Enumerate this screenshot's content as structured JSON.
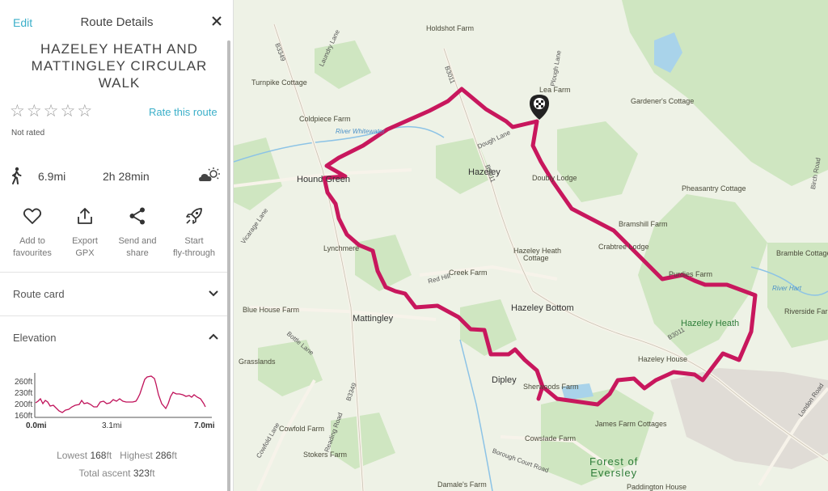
{
  "header": {
    "edit_label": "Edit",
    "title": "Route Details",
    "close_icon": "close-icon"
  },
  "route": {
    "name_line1": "HAZELEY HEATH AND",
    "name_line2": "MATTINGLEY CIRCULAR",
    "name_line3": "WALK"
  },
  "rating": {
    "stars_filled": 0,
    "stars_total": 5,
    "rate_label": "Rate this route",
    "status": "Not rated"
  },
  "stats": {
    "distance_value": "6.9",
    "distance_unit": "mi",
    "hours_value": "2",
    "hours_unit": "h",
    "minutes_value": "28",
    "minutes_unit": "min",
    "walk_icon": "walking-person-icon",
    "weather_icon": "weather-cloud-sun-icon"
  },
  "actions": [
    {
      "icon": "heart-icon",
      "line1": "Add to",
      "line2": "favourites"
    },
    {
      "icon": "export-icon",
      "line1": "Export",
      "line2": "GPX"
    },
    {
      "icon": "share-icon",
      "line1": "Send and",
      "line2": "share"
    },
    {
      "icon": "rocket-icon",
      "line1": "Start",
      "line2": "fly-through"
    }
  ],
  "sections": {
    "route_card": "Route card",
    "elevation": "Elevation"
  },
  "elevation": {
    "y_ticks": [
      "260ft",
      "230ft",
      "200ft",
      "160ft"
    ],
    "x_start": "0.0mi",
    "x_mid": "3.1mi",
    "x_end": "7.0mi",
    "lowest_label": "Lowest",
    "lowest_value": "168",
    "highest_label": "Highest",
    "highest_value": "286",
    "ascent_label": "Total ascent",
    "ascent_value": "323",
    "unit": "ft",
    "line_color": "#c0125a"
  },
  "map": {
    "route_color": "#c8175d",
    "places": {
      "holdshot_farm": "Holdshot Farm",
      "lea_farm": "Lea Farm",
      "gardeners_cottage": "Gardener's Cottage",
      "turnpike_cottage": "Turnpike Cottage",
      "coldpiece_farm": "Coldpiece Farm",
      "hound_green": "Hound Green",
      "hazeley": "Hazeley",
      "doubly_lodge": "Doubly Lodge",
      "pheasantry_cottage": "Pheasantry Cottage",
      "bramshill_farm": "Bramshill Farm",
      "crabtree_lodge": "Crabtree Lodge",
      "lynchmere": "Lynchmere",
      "hazeley_heath_cottage_1": "Hazeley Heath",
      "hazeley_heath_cottage_2": "Cottage",
      "creek_farm": "Creek Farm",
      "bramble_cottage": "Bramble Cottage",
      "purdies_farm": "Purdies Farm",
      "blue_house_farm": "Blue House Farm",
      "mattingley": "Mattingley",
      "hazeley_bottom": "Hazeley Bottom",
      "hazeley_heath": "Hazeley Heath",
      "riverside_farm": "Riverside Farm",
      "hazeley_house": "Hazeley House",
      "grasslands": "Grasslands",
      "dipley": "Dipley",
      "sherwoods_farm": "Sherwoods Farm",
      "james_farm_cottages": "James Farm Cottages",
      "cowfold_farm": "Cowfold Farm",
      "cowslade_farm": "Cowslade Farm",
      "stokers_farm": "Stokers Farm",
      "forest_line1": "Forest of",
      "forest_line2": "Eversley",
      "damales_farm": "Damale's Farm",
      "paddington_house": "Paddington House"
    },
    "roads": {
      "b3349_top": "B3349",
      "b3011_top": "B3011",
      "b3011_mid": "B3011",
      "b3349_bottom": "B3349",
      "b3011_bottom": "B3011",
      "reading_road": "Reading Road",
      "red_hill": "Red Hill",
      "london_road": "London Road",
      "birch_road": "Birch Road",
      "borough_court_road": "Borough Court Road",
      "cowfold_lane": "Cowfold Lane",
      "bottle_lane": "Bottle Lane",
      "vicarage_lane": "Vicarage Lane",
      "plough_lane": "Plough Lane",
      "dough_lane": "Dough Lane",
      "laundry_lane": "Laundry Lane"
    },
    "rivers": {
      "river_whitewater": "River Whitewater",
      "river_hart": "River Hart"
    },
    "marker_icon": "finish-flag-marker-icon"
  }
}
